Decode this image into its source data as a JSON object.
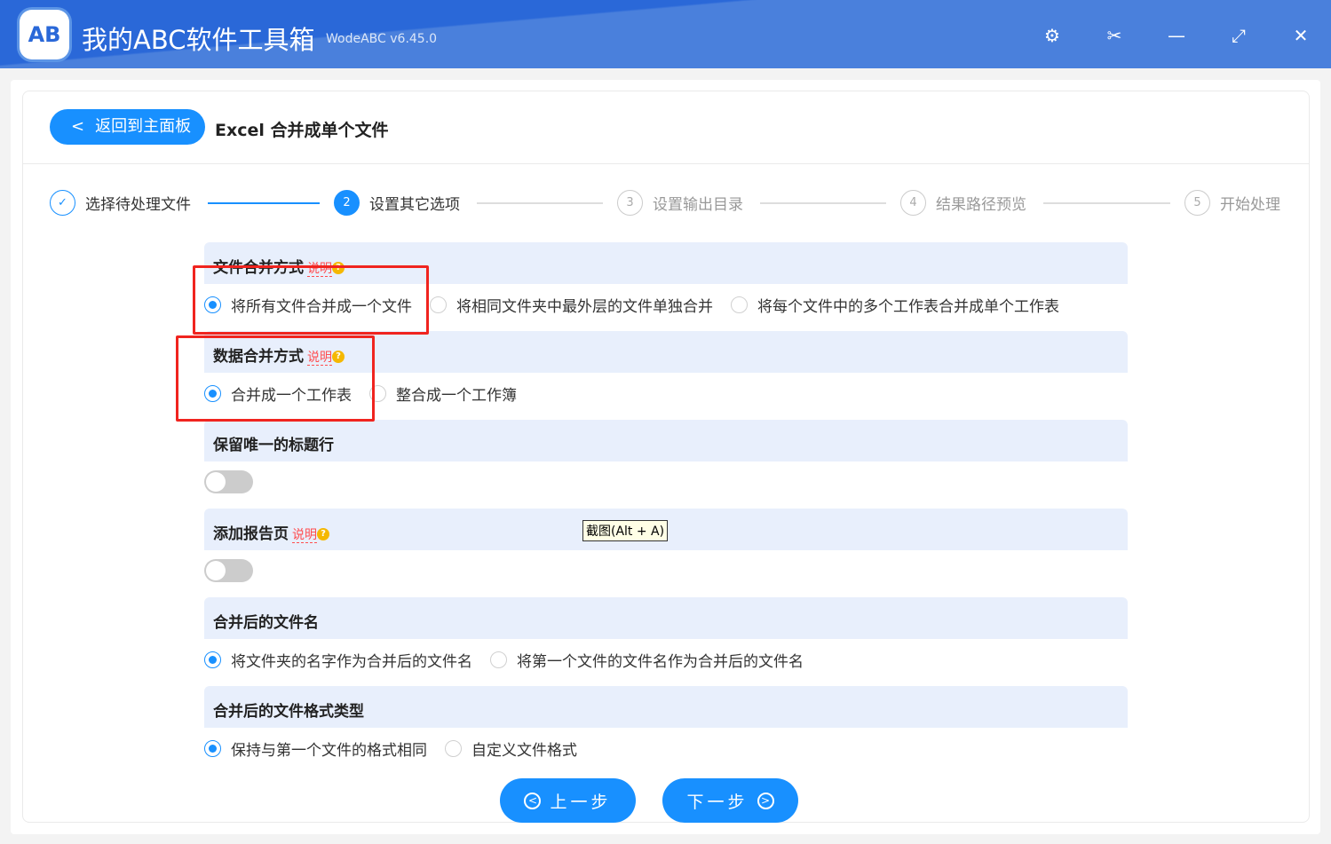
{
  "app": {
    "title": "我的ABC软件工具箱",
    "version": "WodeABC v6.45.0",
    "logo_text": "AB"
  },
  "titlebar": {
    "settings": "⚙",
    "scissors": "✂",
    "minimize": "—",
    "maximize": "⤢",
    "close": "✕"
  },
  "header": {
    "back_label": "返回到主面板",
    "page_title": "Excel 合并成单个文件"
  },
  "steps": [
    {
      "num": "✓",
      "label": "选择待处理文件"
    },
    {
      "num": "2",
      "label": "设置其它选项"
    },
    {
      "num": "3",
      "label": "设置输出目录"
    },
    {
      "num": "4",
      "label": "结果路径预览"
    },
    {
      "num": "5",
      "label": "开始处理"
    }
  ],
  "help_label": "说明",
  "sections": {
    "file_merge": {
      "title": "文件合并方式",
      "options": [
        "将所有文件合并成一个文件",
        "将相同文件夹中最外层的文件单独合并",
        "将每个文件中的多个工作表合并成单个工作表"
      ],
      "selected": 0
    },
    "data_merge": {
      "title": "数据合并方式",
      "options": [
        "合并成一个工作表",
        "整合成一个工作簿"
      ],
      "selected": 0
    },
    "unique_header": {
      "title": "保留唯一的标题行",
      "enabled": false
    },
    "report_page": {
      "title": "添加报告页",
      "enabled": false
    },
    "file_name": {
      "title": "合并后的文件名",
      "options": [
        "将文件夹的名字作为合并后的文件名",
        "将第一个文件的文件名作为合并后的文件名"
      ],
      "selected": 0
    },
    "file_format": {
      "title": "合并后的文件格式类型",
      "options": [
        "保持与第一个文件的格式相同",
        "自定义文件格式"
      ],
      "selected": 0
    }
  },
  "tooltip": "截图(Alt + A)",
  "footer": {
    "prev": "上一步",
    "next": "下一步"
  }
}
